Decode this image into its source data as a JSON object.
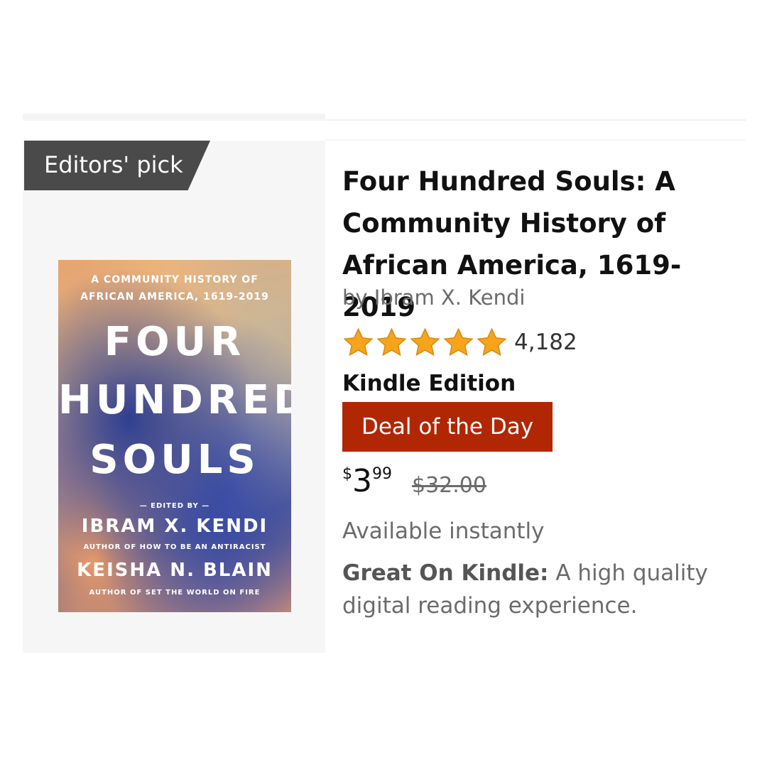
{
  "badge": {
    "label": "Editors' pick"
  },
  "product": {
    "title": "Four Hundred Souls: A Community History of African America, 1619-2019",
    "author": "by Ibram X. Kendi",
    "rating": {
      "stars": 5,
      "count": "4,182"
    },
    "format": "Kindle Edition",
    "deal_label": "Deal of the Day",
    "price": {
      "symbol": "$",
      "whole": "3",
      "fraction": "99"
    },
    "list_price": "$32.00",
    "availability": "Available instantly",
    "feature": {
      "label": "Great On Kindle:",
      "text": "A high quality digital reading experience."
    }
  },
  "cover": {
    "subtitle_line1": "A COMMUNITY HISTORY OF",
    "subtitle_line2": "AFRICAN AMERICA, 1619-2019",
    "title_line1": "FOUR",
    "title_line2": "HUNDRED",
    "title_line3": "SOULS",
    "edited_by": "— EDITED BY —",
    "editor1": "IBRAM X. KENDI",
    "editor1_note": "AUTHOR OF HOW TO BE AN ANTIRACIST",
    "editor2": "KEISHA N. BLAIN",
    "editor2_note": "AUTHOR OF SET THE WORLD ON FIRE"
  },
  "colors": {
    "deal_badge": "#b12704",
    "star": "#f7a41d",
    "editors_badge": "#4a4a4a",
    "muted_text": "#6b6b6b"
  },
  "icons": [
    "star-icon"
  ]
}
